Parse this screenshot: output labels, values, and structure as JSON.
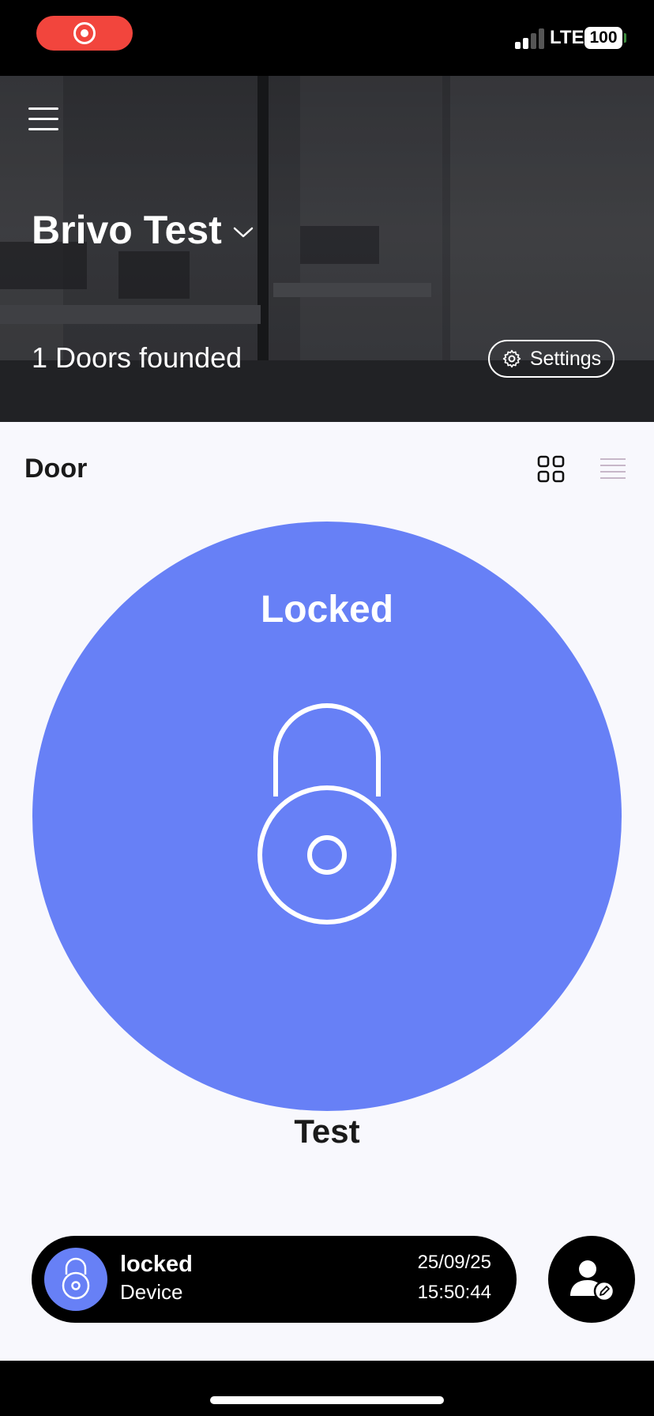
{
  "status_bar": {
    "network": "LTE",
    "battery": "100",
    "colors": {
      "recording": "#f2453d"
    }
  },
  "header": {
    "site_name": "Brivo Test",
    "doors_count": "1 Doors founded",
    "settings_label": "Settings"
  },
  "section": {
    "title": "Door"
  },
  "door": {
    "state": "Locked",
    "name": "Test",
    "color": "#6780f6"
  },
  "last_event": {
    "status": "locked",
    "source": "Device",
    "date": "25/09/25",
    "time": "15:50:44"
  }
}
